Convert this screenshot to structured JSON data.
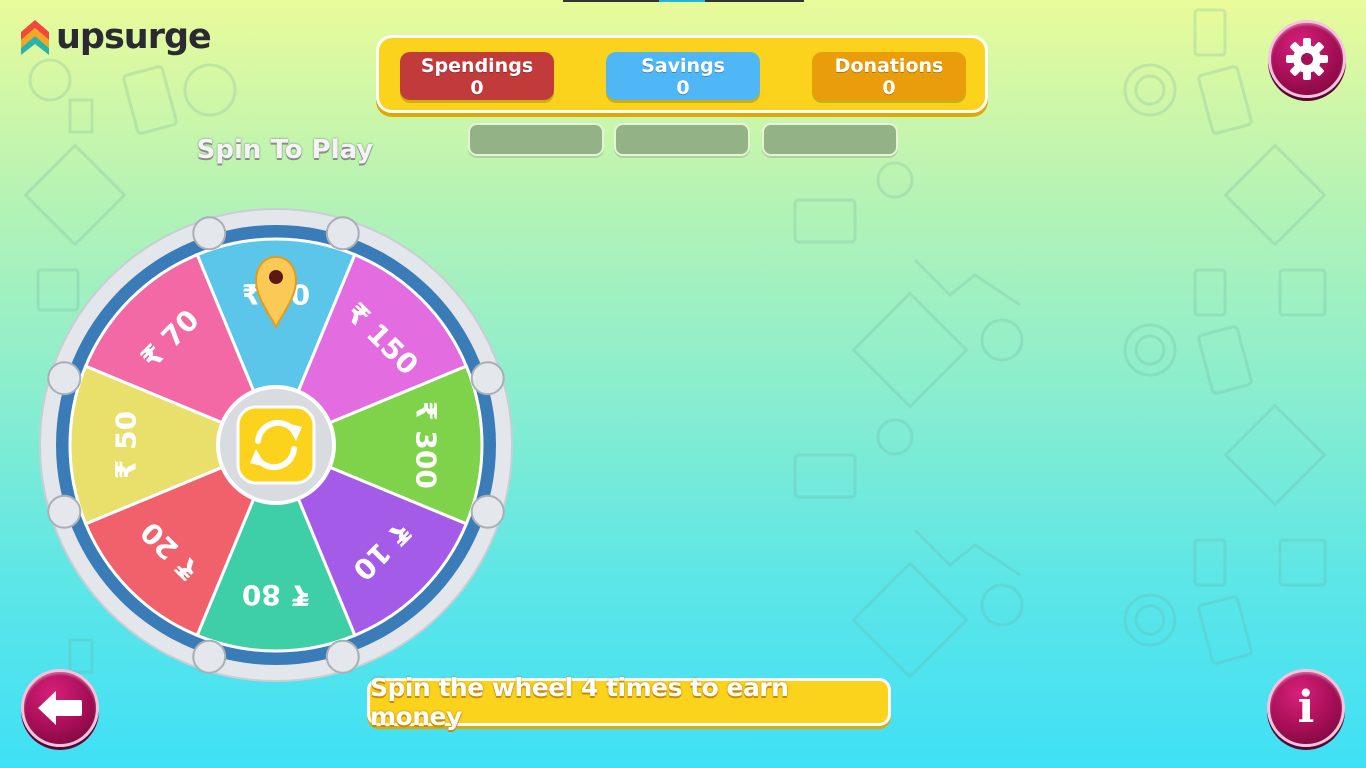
{
  "brand": {
    "name": "upsurge"
  },
  "scores": {
    "spendings": {
      "label": "Spendings",
      "value": "0"
    },
    "savings": {
      "label": "Savings",
      "value": "0"
    },
    "donations": {
      "label": "Donations",
      "value": "0"
    }
  },
  "wheel": {
    "title": "Spin To Play",
    "segments": [
      {
        "label": "₹ 30",
        "color": "#5cc5ea"
      },
      {
        "label": "₹ 150",
        "color": "#e36de0"
      },
      {
        "label": "₹ 300",
        "color": "#7ed34a"
      },
      {
        "label": "₹ 10",
        "color": "#a45ce8"
      },
      {
        "label": "₹ 80",
        "color": "#3ecfa7"
      },
      {
        "label": "₹ 20",
        "color": "#f0616b"
      },
      {
        "label": "₹ 50",
        "color": "#e8e06a"
      },
      {
        "label": "₹ 70",
        "color": "#f269a6"
      }
    ],
    "center_icon": "refresh-icon"
  },
  "message": "Spin the wheel 4 times to earn money",
  "buttons": {
    "settings_icon": "gear-icon",
    "back_icon": "back-arrow-icon",
    "info_icon": "info-icon",
    "info_glyph": "i"
  },
  "colors": {
    "accent_yellow": "#fbd31c",
    "button_magenta": "#a40e55"
  }
}
